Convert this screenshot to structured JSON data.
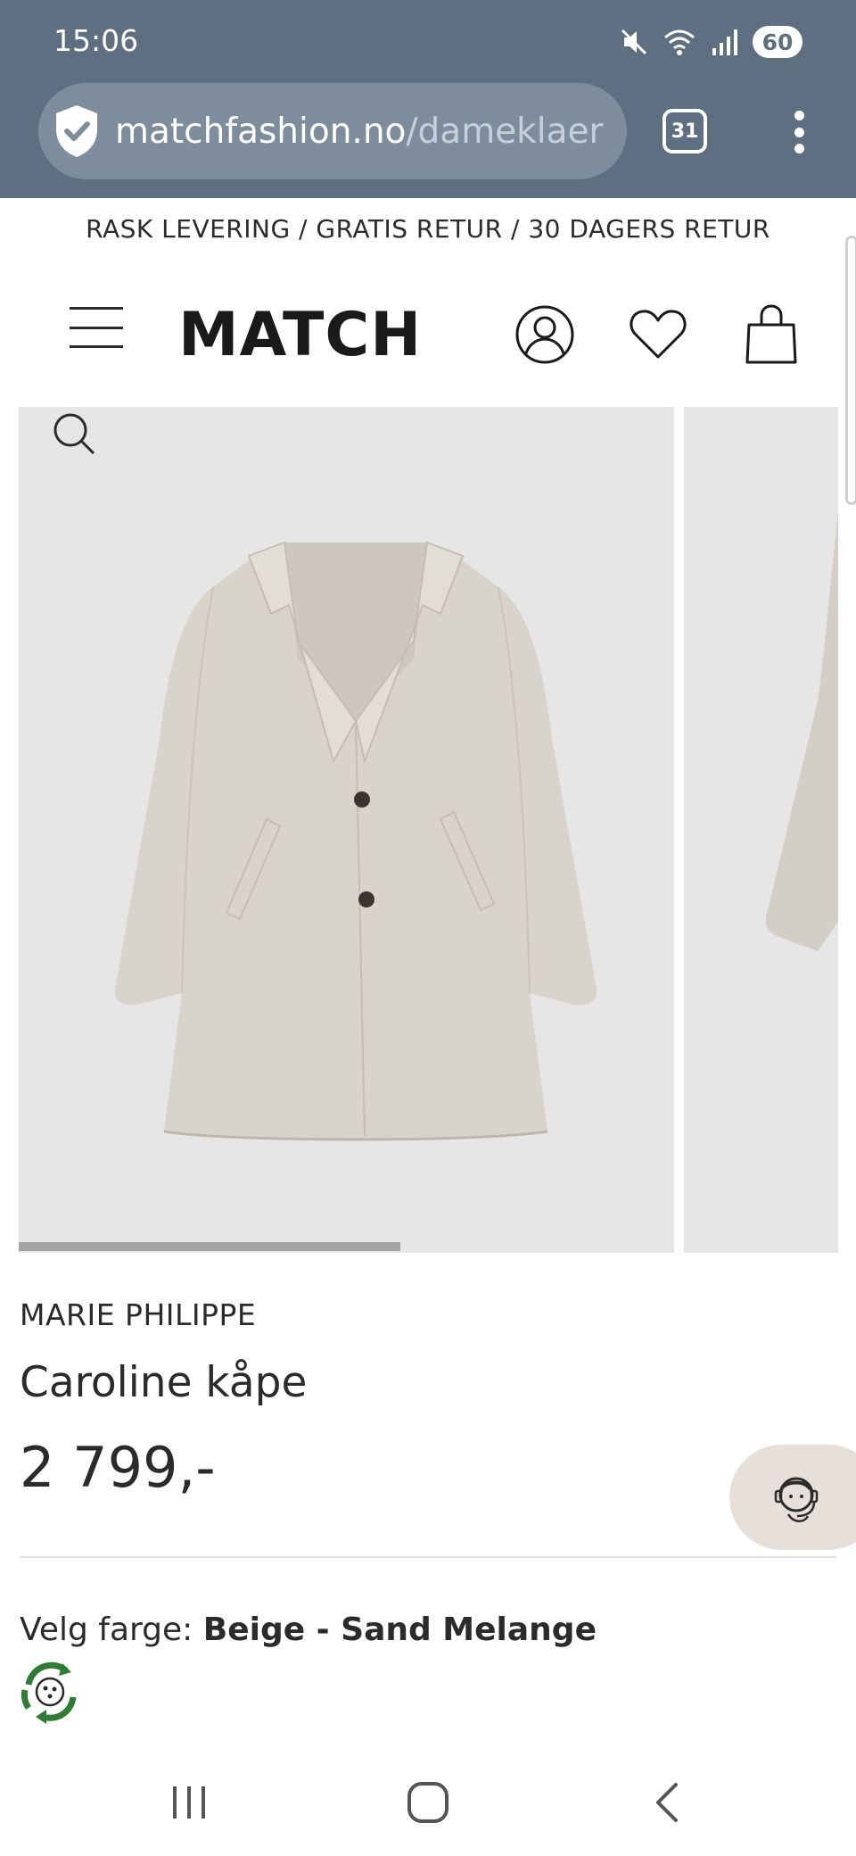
{
  "status_bar": {
    "time": "15:06",
    "battery": "60",
    "icons": [
      "mute-icon",
      "wifi-icon",
      "signal-icon",
      "battery-icon"
    ]
  },
  "browser": {
    "url_domain": "matchfashion.no",
    "url_path": "/dameklaer",
    "tab_count": "31",
    "icons": [
      "shield-check-icon",
      "tabs-icon",
      "more-vert-icon"
    ]
  },
  "announcement": "RASK LEVERING / GRATIS RETUR / 30 DAGERS RETUR",
  "header": {
    "logo": "MATCH",
    "icons": [
      "menu-icon",
      "account-icon",
      "heart-icon",
      "bag-icon"
    ]
  },
  "gallery": {
    "progress": 0.6,
    "icons": [
      "zoom-icon"
    ]
  },
  "product": {
    "brand": "MARIE PHILIPPE",
    "name": "Caroline kåpe",
    "price": "2 799,-",
    "color_label": "Velg farge: ",
    "color_value": "Beige - Sand Melange"
  },
  "support": {
    "icons": [
      "support-agent-icon",
      "eco-cycle-icon"
    ]
  },
  "nav_bar": {
    "icons": [
      "recent-apps-icon",
      "home-icon",
      "back-icon"
    ]
  },
  "colors": {
    "chrome": "#5e6f82",
    "url_bar": "#7e8d9d",
    "gallery_bg": "#e6e6e6",
    "chat_bg": "#e7e0da",
    "eco_green": "#2e7d32",
    "text": "#2b2b2b"
  }
}
